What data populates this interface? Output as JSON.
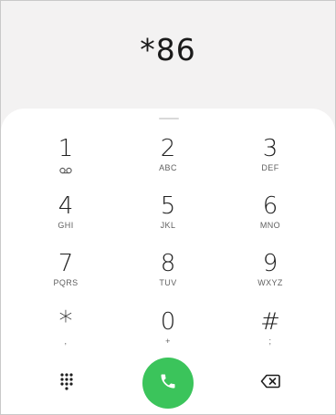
{
  "dialer": {
    "number": "*86"
  },
  "keypad": {
    "keys": [
      {
        "digit": "1",
        "letters": ""
      },
      {
        "digit": "2",
        "letters": "ABC"
      },
      {
        "digit": "3",
        "letters": "DEF"
      },
      {
        "digit": "4",
        "letters": "GHI"
      },
      {
        "digit": "5",
        "letters": "JKL"
      },
      {
        "digit": "6",
        "letters": "MNO"
      },
      {
        "digit": "7",
        "letters": "PQRS"
      },
      {
        "digit": "8",
        "letters": "TUV"
      },
      {
        "digit": "9",
        "letters": "WXYZ"
      },
      {
        "digit": "*",
        "letters": ","
      },
      {
        "digit": "0",
        "letters": "+"
      },
      {
        "digit": "#",
        "letters": ";"
      }
    ]
  },
  "actions": {
    "left_icon": "keypad-grid-icon",
    "call_icon": "phone-icon",
    "right_icon": "backspace-icon"
  },
  "colors": {
    "call_button": "#3bc45b",
    "sheet_background": "#ffffff",
    "page_background": "#f3f2f2"
  }
}
